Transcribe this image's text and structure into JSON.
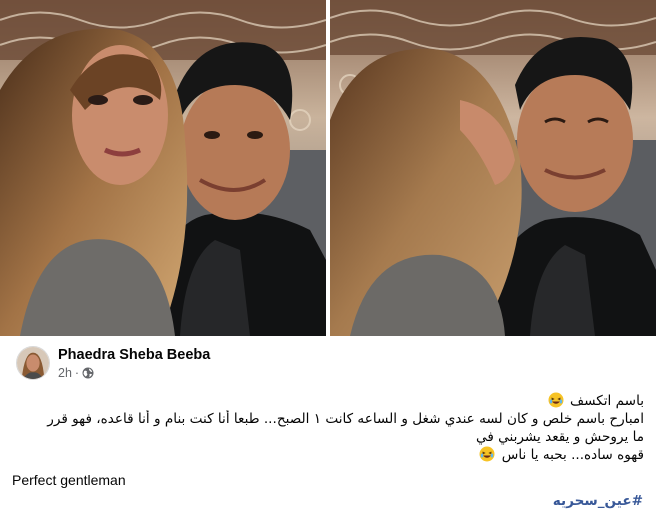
{
  "post": {
    "author": "Phaedra Sheba Beeba",
    "time": "2h",
    "separator": "·",
    "audience_icon": "globe-icon",
    "lines": [
      "باسم اتكسف",
      "امبارح باسم خلص و كان لسه عندي شغل و الساعه كانت ١ الصبح... طبعا أنا كنت بنام و أنا قاعده، فهو قرر",
      "ما يروحش و يقعد يشربني في",
      "قهوه ساده... بحبه يا ناس"
    ],
    "english_line": "Perfect gentleman",
    "hashtag": "#عين_سحريه",
    "emoji": "laughing-emoji"
  },
  "photos": [
    {
      "name": "selfie-photo-left",
      "alt": "couple selfie"
    },
    {
      "name": "selfie-photo-right",
      "alt": "couple selfie kiss"
    }
  ],
  "colors": {
    "link": "#385898",
    "secondary_text": "#65676b",
    "primary_text": "#050505"
  }
}
